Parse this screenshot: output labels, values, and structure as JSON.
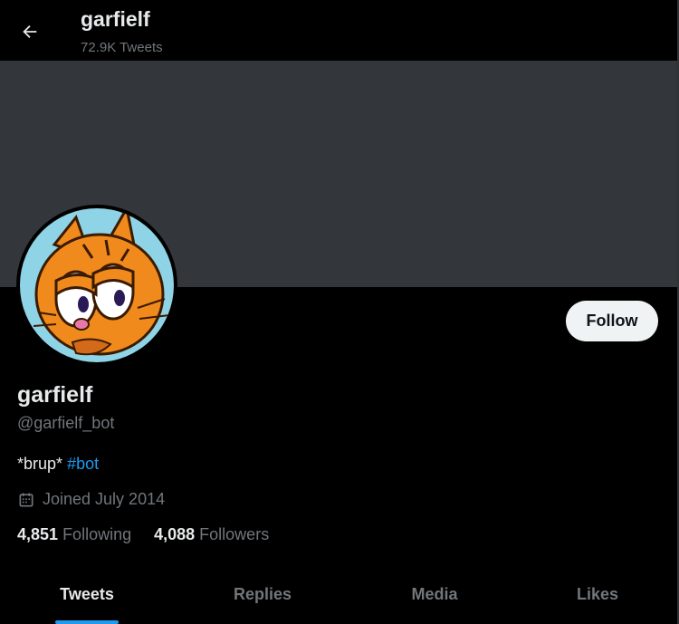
{
  "header": {
    "display_name": "garfielf",
    "tweet_count": "72.9K Tweets"
  },
  "profile": {
    "display_name": "garfielf",
    "handle": "@garfielf_bot",
    "bio_text": "*brup*",
    "bio_hashtag": "#bot",
    "joined": "Joined July 2014",
    "following_count": "4,851",
    "following_label": "Following",
    "followers_count": "4,088",
    "followers_label": "Followers"
  },
  "actions": {
    "follow_label": "Follow"
  },
  "tabs": [
    {
      "label": "Tweets",
      "active": true
    },
    {
      "label": "Replies",
      "active": false
    },
    {
      "label": "Media",
      "active": false
    },
    {
      "label": "Likes",
      "active": false
    }
  ],
  "colors": {
    "accent": "#1d9bf0",
    "banner": "#33363a",
    "background": "#000000"
  },
  "icons": {
    "back": "arrow-left-icon",
    "calendar": "calendar-icon"
  }
}
